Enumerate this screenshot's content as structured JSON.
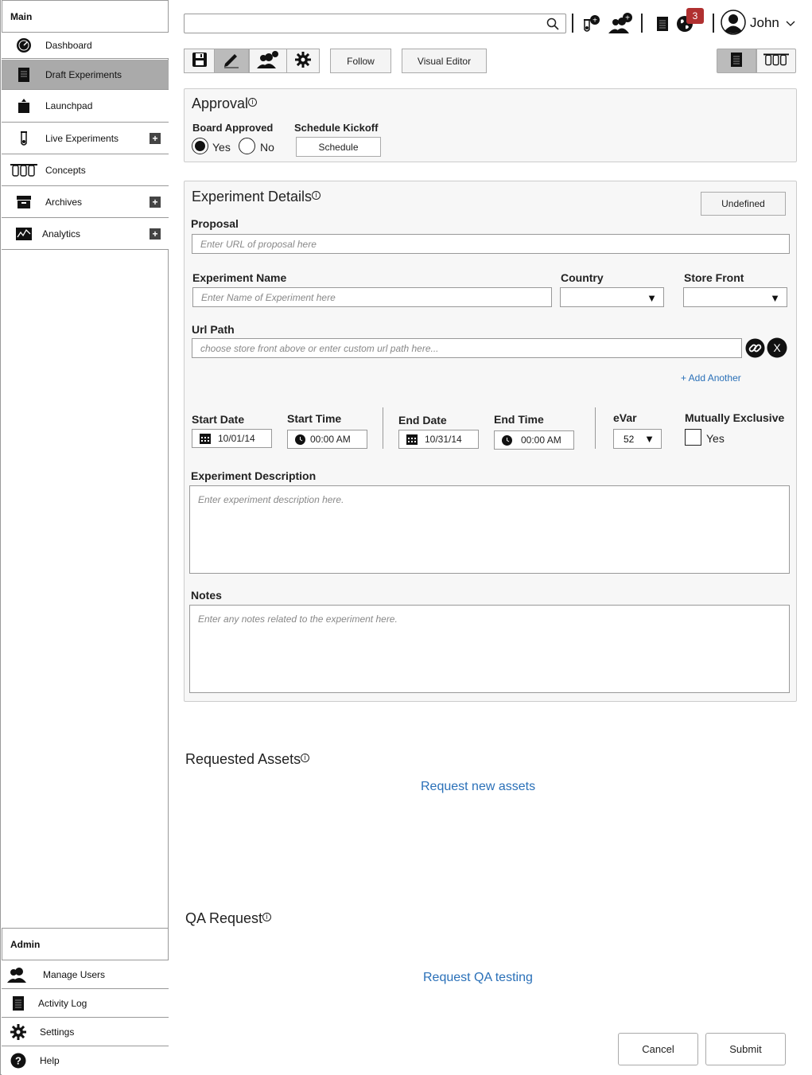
{
  "sidebar": {
    "main_header": "Main",
    "items": [
      {
        "label": "Dashboard",
        "icon": "dashboard-icon"
      },
      {
        "label": "Draft Experiments",
        "icon": "document-icon"
      },
      {
        "label": "Launchpad",
        "icon": "launchpad-icon"
      },
      {
        "label": "Live Experiments",
        "icon": "test-tube-icon"
      },
      {
        "label": "Concepts",
        "icon": "test-tubes-icon"
      },
      {
        "label": "Archives",
        "icon": "archive-box-icon"
      },
      {
        "label": "Analytics",
        "icon": "analytics-chart-icon"
      }
    ],
    "admin_header": "Admin",
    "admin_items": [
      {
        "label": "Manage Users",
        "icon": "users-icon"
      },
      {
        "label": "Activity Log",
        "icon": "log-icon"
      },
      {
        "label": "Settings",
        "icon": "gear-icon"
      },
      {
        "label": "Help",
        "icon": "help-icon"
      }
    ]
  },
  "topbar": {
    "search_placeholder": "",
    "notification_count": "3",
    "user_name": "John"
  },
  "toolbar": {
    "follow": "Follow",
    "visual_editor": "Visual Editor"
  },
  "approval": {
    "title": "Approval",
    "board_approved_label": "Board Approved",
    "yes": "Yes",
    "no": "No",
    "selected": "Yes",
    "schedule_kickoff_label": "Schedule Kickoff",
    "schedule_button": "Schedule"
  },
  "details": {
    "title": "Experiment Details",
    "status_button": "Undefined",
    "proposal_label": "Proposal",
    "proposal_placeholder": "Enter URL of proposal here",
    "name_label": "Experiment Name",
    "name_placeholder": "Enter Name of Experiment here",
    "country_label": "Country",
    "country_value": "",
    "storefront_label": "Store Front",
    "storefront_value": "",
    "url_label": "Url Path",
    "url_placeholder": "choose store front above or enter custom url path here...",
    "add_another": "+ Add Another",
    "start_date_label": "Start Date",
    "start_date": "10/01/14",
    "start_time_label": "Start Time",
    "start_time": "00:00 AM",
    "end_date_label": "End Date",
    "end_date": "10/31/14",
    "end_time_label": "End Time",
    "end_time": "00:00 AM",
    "evar_label": "eVar",
    "evar_value": "52",
    "mutually_exclusive_label": "Mutually Exclusive",
    "mutually_exclusive_option": "Yes",
    "mutually_exclusive_checked": false,
    "description_label": "Experiment Description",
    "description_placeholder": "Enter experiment description here.",
    "notes_label": "Notes",
    "notes_placeholder": "Enter any notes related to the experiment here."
  },
  "assets": {
    "title": "Requested Assets",
    "link": "Request new assets"
  },
  "qa": {
    "title": "QA Request",
    "link": "Request QA testing"
  },
  "footer": {
    "cancel": "Cancel",
    "submit": "Submit"
  }
}
